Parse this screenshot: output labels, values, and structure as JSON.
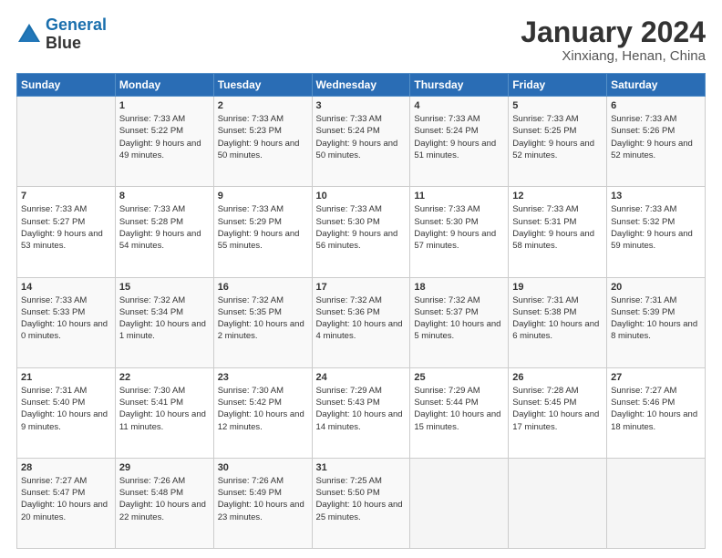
{
  "logo": {
    "line1": "General",
    "line2": "Blue"
  },
  "title": "January 2024",
  "subtitle": "Xinxiang, Henan, China",
  "days_of_week": [
    "Sunday",
    "Monday",
    "Tuesday",
    "Wednesday",
    "Thursday",
    "Friday",
    "Saturday"
  ],
  "weeks": [
    [
      {
        "day": "",
        "sunrise": "",
        "sunset": "",
        "daylight": ""
      },
      {
        "day": "1",
        "sunrise": "7:33 AM",
        "sunset": "5:22 PM",
        "daylight": "9 hours and 49 minutes."
      },
      {
        "day": "2",
        "sunrise": "7:33 AM",
        "sunset": "5:23 PM",
        "daylight": "9 hours and 50 minutes."
      },
      {
        "day": "3",
        "sunrise": "7:33 AM",
        "sunset": "5:24 PM",
        "daylight": "9 hours and 50 minutes."
      },
      {
        "day": "4",
        "sunrise": "7:33 AM",
        "sunset": "5:24 PM",
        "daylight": "9 hours and 51 minutes."
      },
      {
        "day": "5",
        "sunrise": "7:33 AM",
        "sunset": "5:25 PM",
        "daylight": "9 hours and 52 minutes."
      },
      {
        "day": "6",
        "sunrise": "7:33 AM",
        "sunset": "5:26 PM",
        "daylight": "9 hours and 52 minutes."
      }
    ],
    [
      {
        "day": "7",
        "sunrise": "7:33 AM",
        "sunset": "5:27 PM",
        "daylight": "9 hours and 53 minutes."
      },
      {
        "day": "8",
        "sunrise": "7:33 AM",
        "sunset": "5:28 PM",
        "daylight": "9 hours and 54 minutes."
      },
      {
        "day": "9",
        "sunrise": "7:33 AM",
        "sunset": "5:29 PM",
        "daylight": "9 hours and 55 minutes."
      },
      {
        "day": "10",
        "sunrise": "7:33 AM",
        "sunset": "5:30 PM",
        "daylight": "9 hours and 56 minutes."
      },
      {
        "day": "11",
        "sunrise": "7:33 AM",
        "sunset": "5:30 PM",
        "daylight": "9 hours and 57 minutes."
      },
      {
        "day": "12",
        "sunrise": "7:33 AM",
        "sunset": "5:31 PM",
        "daylight": "9 hours and 58 minutes."
      },
      {
        "day": "13",
        "sunrise": "7:33 AM",
        "sunset": "5:32 PM",
        "daylight": "9 hours and 59 minutes."
      }
    ],
    [
      {
        "day": "14",
        "sunrise": "7:33 AM",
        "sunset": "5:33 PM",
        "daylight": "10 hours and 0 minutes."
      },
      {
        "day": "15",
        "sunrise": "7:32 AM",
        "sunset": "5:34 PM",
        "daylight": "10 hours and 1 minute."
      },
      {
        "day": "16",
        "sunrise": "7:32 AM",
        "sunset": "5:35 PM",
        "daylight": "10 hours and 2 minutes."
      },
      {
        "day": "17",
        "sunrise": "7:32 AM",
        "sunset": "5:36 PM",
        "daylight": "10 hours and 4 minutes."
      },
      {
        "day": "18",
        "sunrise": "7:32 AM",
        "sunset": "5:37 PM",
        "daylight": "10 hours and 5 minutes."
      },
      {
        "day": "19",
        "sunrise": "7:31 AM",
        "sunset": "5:38 PM",
        "daylight": "10 hours and 6 minutes."
      },
      {
        "day": "20",
        "sunrise": "7:31 AM",
        "sunset": "5:39 PM",
        "daylight": "10 hours and 8 minutes."
      }
    ],
    [
      {
        "day": "21",
        "sunrise": "7:31 AM",
        "sunset": "5:40 PM",
        "daylight": "10 hours and 9 minutes."
      },
      {
        "day": "22",
        "sunrise": "7:30 AM",
        "sunset": "5:41 PM",
        "daylight": "10 hours and 11 minutes."
      },
      {
        "day": "23",
        "sunrise": "7:30 AM",
        "sunset": "5:42 PM",
        "daylight": "10 hours and 12 minutes."
      },
      {
        "day": "24",
        "sunrise": "7:29 AM",
        "sunset": "5:43 PM",
        "daylight": "10 hours and 14 minutes."
      },
      {
        "day": "25",
        "sunrise": "7:29 AM",
        "sunset": "5:44 PM",
        "daylight": "10 hours and 15 minutes."
      },
      {
        "day": "26",
        "sunrise": "7:28 AM",
        "sunset": "5:45 PM",
        "daylight": "10 hours and 17 minutes."
      },
      {
        "day": "27",
        "sunrise": "7:27 AM",
        "sunset": "5:46 PM",
        "daylight": "10 hours and 18 minutes."
      }
    ],
    [
      {
        "day": "28",
        "sunrise": "7:27 AM",
        "sunset": "5:47 PM",
        "daylight": "10 hours and 20 minutes."
      },
      {
        "day": "29",
        "sunrise": "7:26 AM",
        "sunset": "5:48 PM",
        "daylight": "10 hours and 22 minutes."
      },
      {
        "day": "30",
        "sunrise": "7:26 AM",
        "sunset": "5:49 PM",
        "daylight": "10 hours and 23 minutes."
      },
      {
        "day": "31",
        "sunrise": "7:25 AM",
        "sunset": "5:50 PM",
        "daylight": "10 hours and 25 minutes."
      },
      {
        "day": "",
        "sunrise": "",
        "sunset": "",
        "daylight": ""
      },
      {
        "day": "",
        "sunrise": "",
        "sunset": "",
        "daylight": ""
      },
      {
        "day": "",
        "sunrise": "",
        "sunset": "",
        "daylight": ""
      }
    ]
  ]
}
